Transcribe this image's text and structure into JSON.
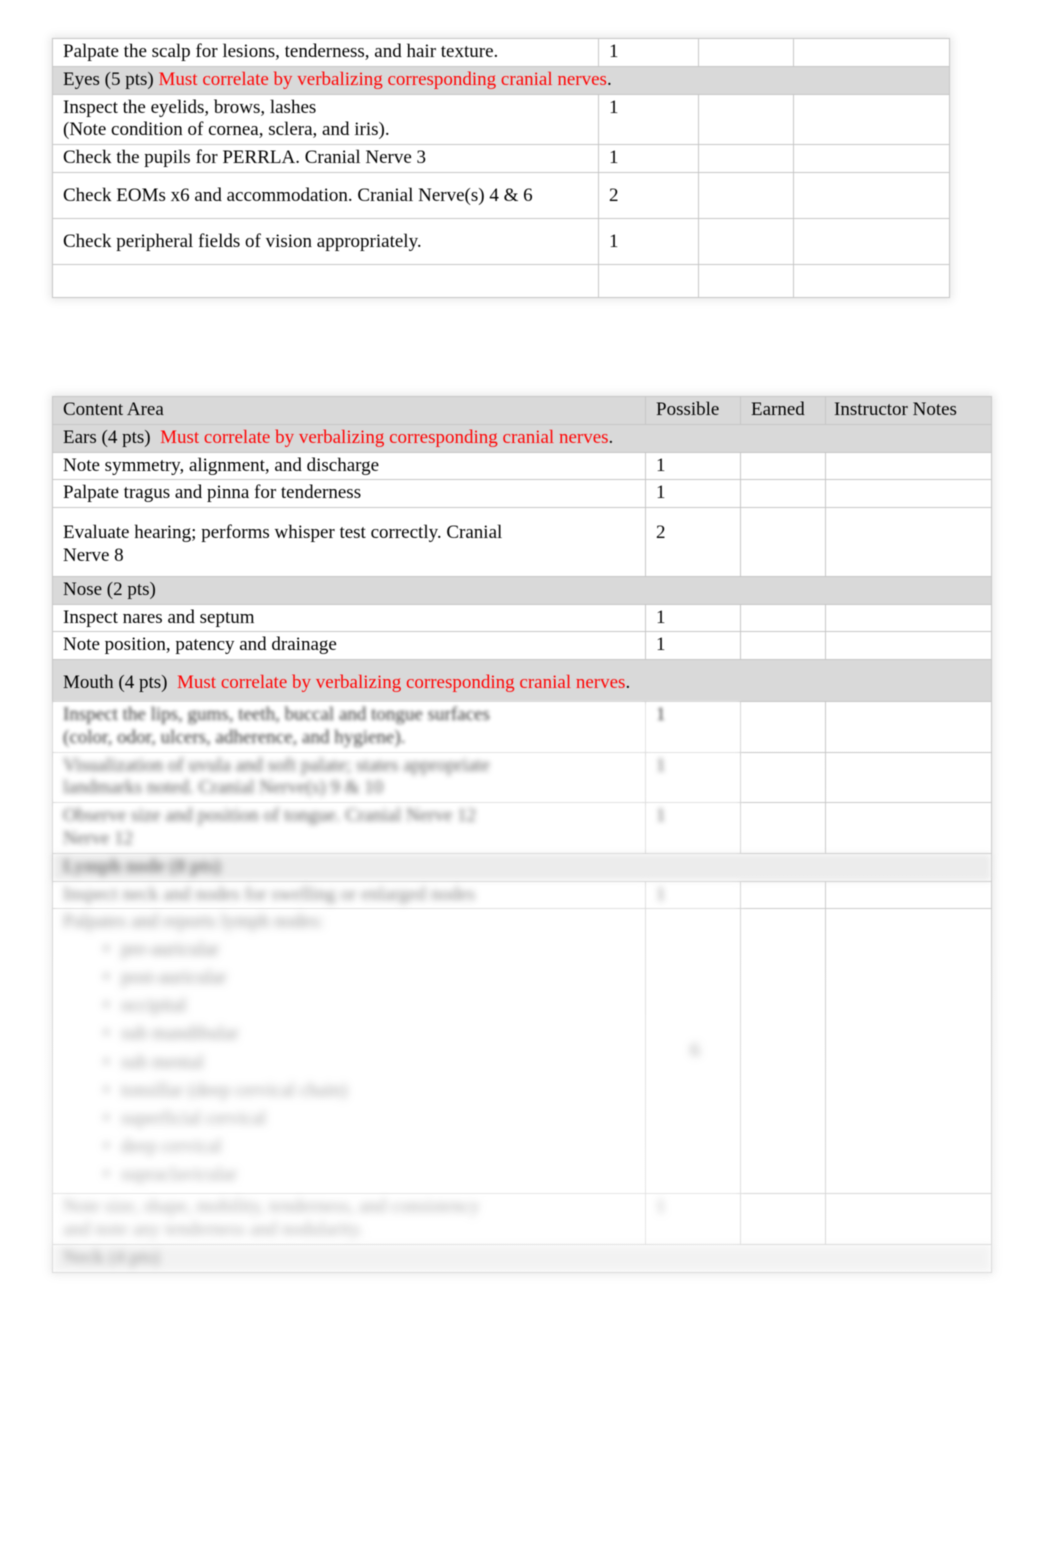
{
  "document": {
    "type": "physical-assessment-grading-rubric",
    "accent_color": "#ff0000",
    "section_header_bg": "#d9d9d9",
    "border_color": "#c6c6c6"
  },
  "table_one": {
    "rows": [
      {
        "kind": "item",
        "content": "Palpate the scalp for lesions, tenderness, and hair texture.",
        "possible": "1",
        "earned": "",
        "notes": ""
      },
      {
        "kind": "section",
        "label": "Eyes (5 pts)",
        "note": "Must correlate by verbalizing corresponding cranial nerves",
        "note_tail": "."
      },
      {
        "kind": "item",
        "content": "Inspect the eyelids, brows, lashes",
        "content_line2": "(Note condition of cornea, sclera, and iris).",
        "possible": "1",
        "earned": "",
        "notes": ""
      },
      {
        "kind": "item",
        "content": "Check the pupils for PERRLA. Cranial Nerve   3",
        "possible": "1",
        "earned": "",
        "notes": ""
      },
      {
        "kind": "item",
        "content": "Check EOMs x6 and accommodation. Cranial Nerve(s)   4 & 6",
        "possible": "2",
        "earned": "",
        "notes": ""
      },
      {
        "kind": "item",
        "content": "Check peripheral fields of vision appropriately.",
        "possible": "1",
        "earned": "",
        "notes": ""
      }
    ]
  },
  "table_two": {
    "columns": {
      "content_area": "Content Area",
      "possible": "Possible",
      "earned": "Earned",
      "instructor_notes": "Instructor Notes"
    },
    "rows": [
      {
        "kind": "section",
        "label": "Ears (4 pts)",
        "note": "Must correlate by verbalizing corresponding cranial nerves",
        "note_tail": "."
      },
      {
        "kind": "item",
        "content": "Note symmetry, alignment, and discharge",
        "possible": "1",
        "earned": "",
        "notes": ""
      },
      {
        "kind": "item",
        "content": "Palpate tragus and pinna for tenderness",
        "possible": "1",
        "earned": "",
        "notes": ""
      },
      {
        "kind": "item",
        "content": "Evaluate hearing; performs whisper test correctly.  Cranial",
        "content_line2": "Nerve 8",
        "possible": "2",
        "earned": "",
        "notes": ""
      },
      {
        "kind": "section",
        "label": "Nose (2 pts)",
        "note": "",
        "note_tail": ""
      },
      {
        "kind": "item",
        "content": "Inspect nares and septum",
        "possible": "1",
        "earned": "",
        "notes": ""
      },
      {
        "kind": "item",
        "content": "Note position, patency and drainage",
        "possible": "1",
        "earned": "",
        "notes": ""
      },
      {
        "kind": "section",
        "label": "Mouth (4 pts)",
        "note": "Must correlate by verbalizing corresponding cranial nerves",
        "note_tail": "."
      }
    ],
    "redacted_rows": [
      {
        "kind": "item",
        "blur": "blur-1",
        "content": "Inspect the lips, gums, teeth, buccal and tongue surfaces",
        "content_line2": "(color, odor, ulcers, adherence, and hygiene).",
        "possible": "1",
        "earned": "",
        "notes": ""
      },
      {
        "kind": "item",
        "blur": "blur-2",
        "content": "Visualization of uvula and soft palate; states appropriate",
        "content_line2": "landmarks noted. Cranial Nerve(s) 9 & 10",
        "possible": "1",
        "earned": "",
        "notes": ""
      },
      {
        "kind": "item",
        "blur": "blur-2",
        "content": "Observe size and position of tongue. Cranial Nerve 12",
        "content_line2": "Nerve 12",
        "possible": "1",
        "earned": "",
        "notes": ""
      },
      {
        "kind": "section",
        "blur": "blur-3",
        "label": "Lymph node (8 pts)",
        "note": "",
        "note_tail": ""
      },
      {
        "kind": "item",
        "blur": "blur-3",
        "content": "Inspect neck and nodes for swelling or enlarged nodes",
        "possible": "1",
        "earned": "",
        "notes": ""
      },
      {
        "kind": "item-list",
        "blur": "blur-4",
        "content": "Palpates and reports lymph nodes:",
        "bullets": [
          "pre-auricular",
          "post-auricular",
          "occipital",
          "sub mandibular",
          "sub mental",
          "tonsillar (deep cervical chain)",
          "superficial cervical",
          "deep cervical",
          "supraclavicular"
        ],
        "possible": "6",
        "earned": "",
        "notes": ""
      },
      {
        "kind": "item",
        "blur": "blur-4",
        "content": "Note size, shape, mobility, tenderness, and consistency",
        "content_line2": "and note any tenderness and nodularity.",
        "possible": "1",
        "earned": "",
        "notes": ""
      },
      {
        "kind": "section",
        "blur": "blur-4",
        "label": "Neck (4 pts)",
        "note": "",
        "note_tail": ""
      }
    ]
  }
}
